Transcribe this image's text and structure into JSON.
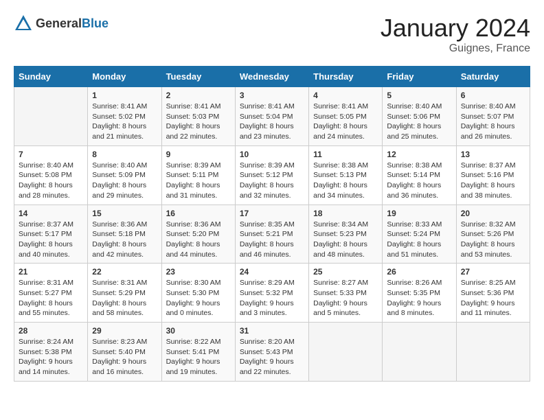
{
  "logo": {
    "general": "General",
    "blue": "Blue"
  },
  "header": {
    "title": "January 2024",
    "subtitle": "Guignes, France"
  },
  "days_of_week": [
    "Sunday",
    "Monday",
    "Tuesday",
    "Wednesday",
    "Thursday",
    "Friday",
    "Saturday"
  ],
  "weeks": [
    [
      {
        "day": "",
        "info": ""
      },
      {
        "day": "1",
        "info": "Sunrise: 8:41 AM\nSunset: 5:02 PM\nDaylight: 8 hours\nand 21 minutes."
      },
      {
        "day": "2",
        "info": "Sunrise: 8:41 AM\nSunset: 5:03 PM\nDaylight: 8 hours\nand 22 minutes."
      },
      {
        "day": "3",
        "info": "Sunrise: 8:41 AM\nSunset: 5:04 PM\nDaylight: 8 hours\nand 23 minutes."
      },
      {
        "day": "4",
        "info": "Sunrise: 8:41 AM\nSunset: 5:05 PM\nDaylight: 8 hours\nand 24 minutes."
      },
      {
        "day": "5",
        "info": "Sunrise: 8:40 AM\nSunset: 5:06 PM\nDaylight: 8 hours\nand 25 minutes."
      },
      {
        "day": "6",
        "info": "Sunrise: 8:40 AM\nSunset: 5:07 PM\nDaylight: 8 hours\nand 26 minutes."
      }
    ],
    [
      {
        "day": "7",
        "info": "Sunrise: 8:40 AM\nSunset: 5:08 PM\nDaylight: 8 hours\nand 28 minutes."
      },
      {
        "day": "8",
        "info": "Sunrise: 8:40 AM\nSunset: 5:09 PM\nDaylight: 8 hours\nand 29 minutes."
      },
      {
        "day": "9",
        "info": "Sunrise: 8:39 AM\nSunset: 5:11 PM\nDaylight: 8 hours\nand 31 minutes."
      },
      {
        "day": "10",
        "info": "Sunrise: 8:39 AM\nSunset: 5:12 PM\nDaylight: 8 hours\nand 32 minutes."
      },
      {
        "day": "11",
        "info": "Sunrise: 8:38 AM\nSunset: 5:13 PM\nDaylight: 8 hours\nand 34 minutes."
      },
      {
        "day": "12",
        "info": "Sunrise: 8:38 AM\nSunset: 5:14 PM\nDaylight: 8 hours\nand 36 minutes."
      },
      {
        "day": "13",
        "info": "Sunrise: 8:37 AM\nSunset: 5:16 PM\nDaylight: 8 hours\nand 38 minutes."
      }
    ],
    [
      {
        "day": "14",
        "info": "Sunrise: 8:37 AM\nSunset: 5:17 PM\nDaylight: 8 hours\nand 40 minutes."
      },
      {
        "day": "15",
        "info": "Sunrise: 8:36 AM\nSunset: 5:18 PM\nDaylight: 8 hours\nand 42 minutes."
      },
      {
        "day": "16",
        "info": "Sunrise: 8:36 AM\nSunset: 5:20 PM\nDaylight: 8 hours\nand 44 minutes."
      },
      {
        "day": "17",
        "info": "Sunrise: 8:35 AM\nSunset: 5:21 PM\nDaylight: 8 hours\nand 46 minutes."
      },
      {
        "day": "18",
        "info": "Sunrise: 8:34 AM\nSunset: 5:23 PM\nDaylight: 8 hours\nand 48 minutes."
      },
      {
        "day": "19",
        "info": "Sunrise: 8:33 AM\nSunset: 5:24 PM\nDaylight: 8 hours\nand 51 minutes."
      },
      {
        "day": "20",
        "info": "Sunrise: 8:32 AM\nSunset: 5:26 PM\nDaylight: 8 hours\nand 53 minutes."
      }
    ],
    [
      {
        "day": "21",
        "info": "Sunrise: 8:31 AM\nSunset: 5:27 PM\nDaylight: 8 hours\nand 55 minutes."
      },
      {
        "day": "22",
        "info": "Sunrise: 8:31 AM\nSunset: 5:29 PM\nDaylight: 8 hours\nand 58 minutes."
      },
      {
        "day": "23",
        "info": "Sunrise: 8:30 AM\nSunset: 5:30 PM\nDaylight: 9 hours\nand 0 minutes."
      },
      {
        "day": "24",
        "info": "Sunrise: 8:29 AM\nSunset: 5:32 PM\nDaylight: 9 hours\nand 3 minutes."
      },
      {
        "day": "25",
        "info": "Sunrise: 8:27 AM\nSunset: 5:33 PM\nDaylight: 9 hours\nand 5 minutes."
      },
      {
        "day": "26",
        "info": "Sunrise: 8:26 AM\nSunset: 5:35 PM\nDaylight: 9 hours\nand 8 minutes."
      },
      {
        "day": "27",
        "info": "Sunrise: 8:25 AM\nSunset: 5:36 PM\nDaylight: 9 hours\nand 11 minutes."
      }
    ],
    [
      {
        "day": "28",
        "info": "Sunrise: 8:24 AM\nSunset: 5:38 PM\nDaylight: 9 hours\nand 14 minutes."
      },
      {
        "day": "29",
        "info": "Sunrise: 8:23 AM\nSunset: 5:40 PM\nDaylight: 9 hours\nand 16 minutes."
      },
      {
        "day": "30",
        "info": "Sunrise: 8:22 AM\nSunset: 5:41 PM\nDaylight: 9 hours\nand 19 minutes."
      },
      {
        "day": "31",
        "info": "Sunrise: 8:20 AM\nSunset: 5:43 PM\nDaylight: 9 hours\nand 22 minutes."
      },
      {
        "day": "",
        "info": ""
      },
      {
        "day": "",
        "info": ""
      },
      {
        "day": "",
        "info": ""
      }
    ]
  ]
}
